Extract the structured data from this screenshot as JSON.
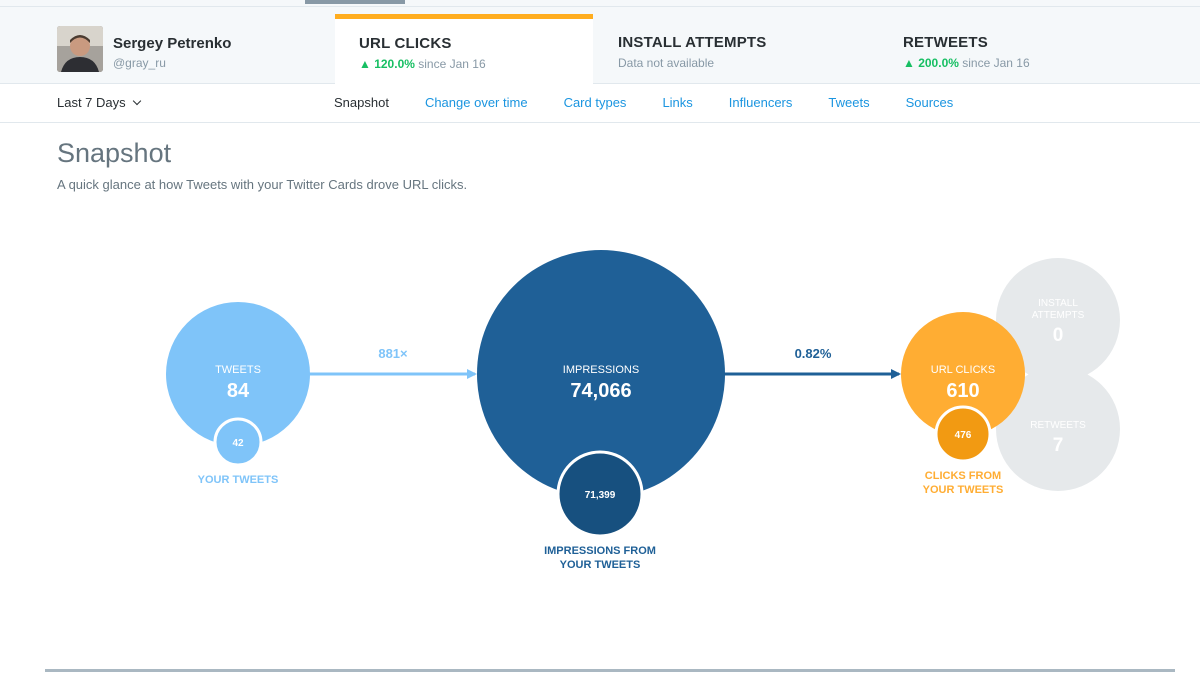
{
  "profile": {
    "name": "Sergey Petrenko",
    "handle": "@gray_ru"
  },
  "metric_tabs": [
    {
      "title": "URL CLICKS",
      "change": "▲ 120.0%",
      "since": " since Jan 16",
      "active": true
    },
    {
      "title": "INSTALL ATTEMPTS",
      "note": "Data not available"
    },
    {
      "title": "RETWEETS",
      "change": "▲ 200.0%",
      "since": " since Jan 16"
    }
  ],
  "date_range": "Last 7 Days",
  "subnav_tabs": [
    "Snapshot",
    "Change over time",
    "Card types",
    "Links",
    "Influencers",
    "Tweets",
    "Sources"
  ],
  "page": {
    "title": "Snapshot",
    "description": "A quick glance at how Tweets with your Twitter Cards drove URL clicks."
  },
  "snapshot": {
    "tweets": {
      "label": "TWEETS",
      "value": "84",
      "own_value": "42",
      "own_label": "YOUR TWEETS"
    },
    "ratio_tweets_to_impressions": "881×",
    "impressions": {
      "label": "IMPRESSIONS",
      "value": "74,066",
      "own_value": "71,399",
      "own_label_1": "IMPRESSIONS FROM",
      "own_label_2": "YOUR TWEETS"
    },
    "ratio_impressions_to_clicks": "0.82%",
    "url_clicks": {
      "label": "URL CLICKS",
      "value": "610",
      "own_value": "476",
      "own_label_1": "CLICKS FROM",
      "own_label_2": "YOUR TWEETS"
    },
    "install_attempts": {
      "label_1": "INSTALL",
      "label_2": "ATTEMPTS",
      "value": "0"
    },
    "retweets": {
      "label": "RETWEETS",
      "value": "7"
    }
  },
  "colors": {
    "tweets": "#7fc4f9",
    "impressions": "#1f6097",
    "impressions_dark": "#17507f",
    "clicks": "#ffad33",
    "clicks_dark": "#f29a12",
    "inactive": "#e6e9eb",
    "tab_accent": "#ffad1f",
    "positive": "#17bf63",
    "link": "#1b95e0"
  },
  "icons": {
    "range_dropdown": "chevron-down-icon",
    "avatar": "user-avatar",
    "arrows": "arrow-right-icon"
  }
}
